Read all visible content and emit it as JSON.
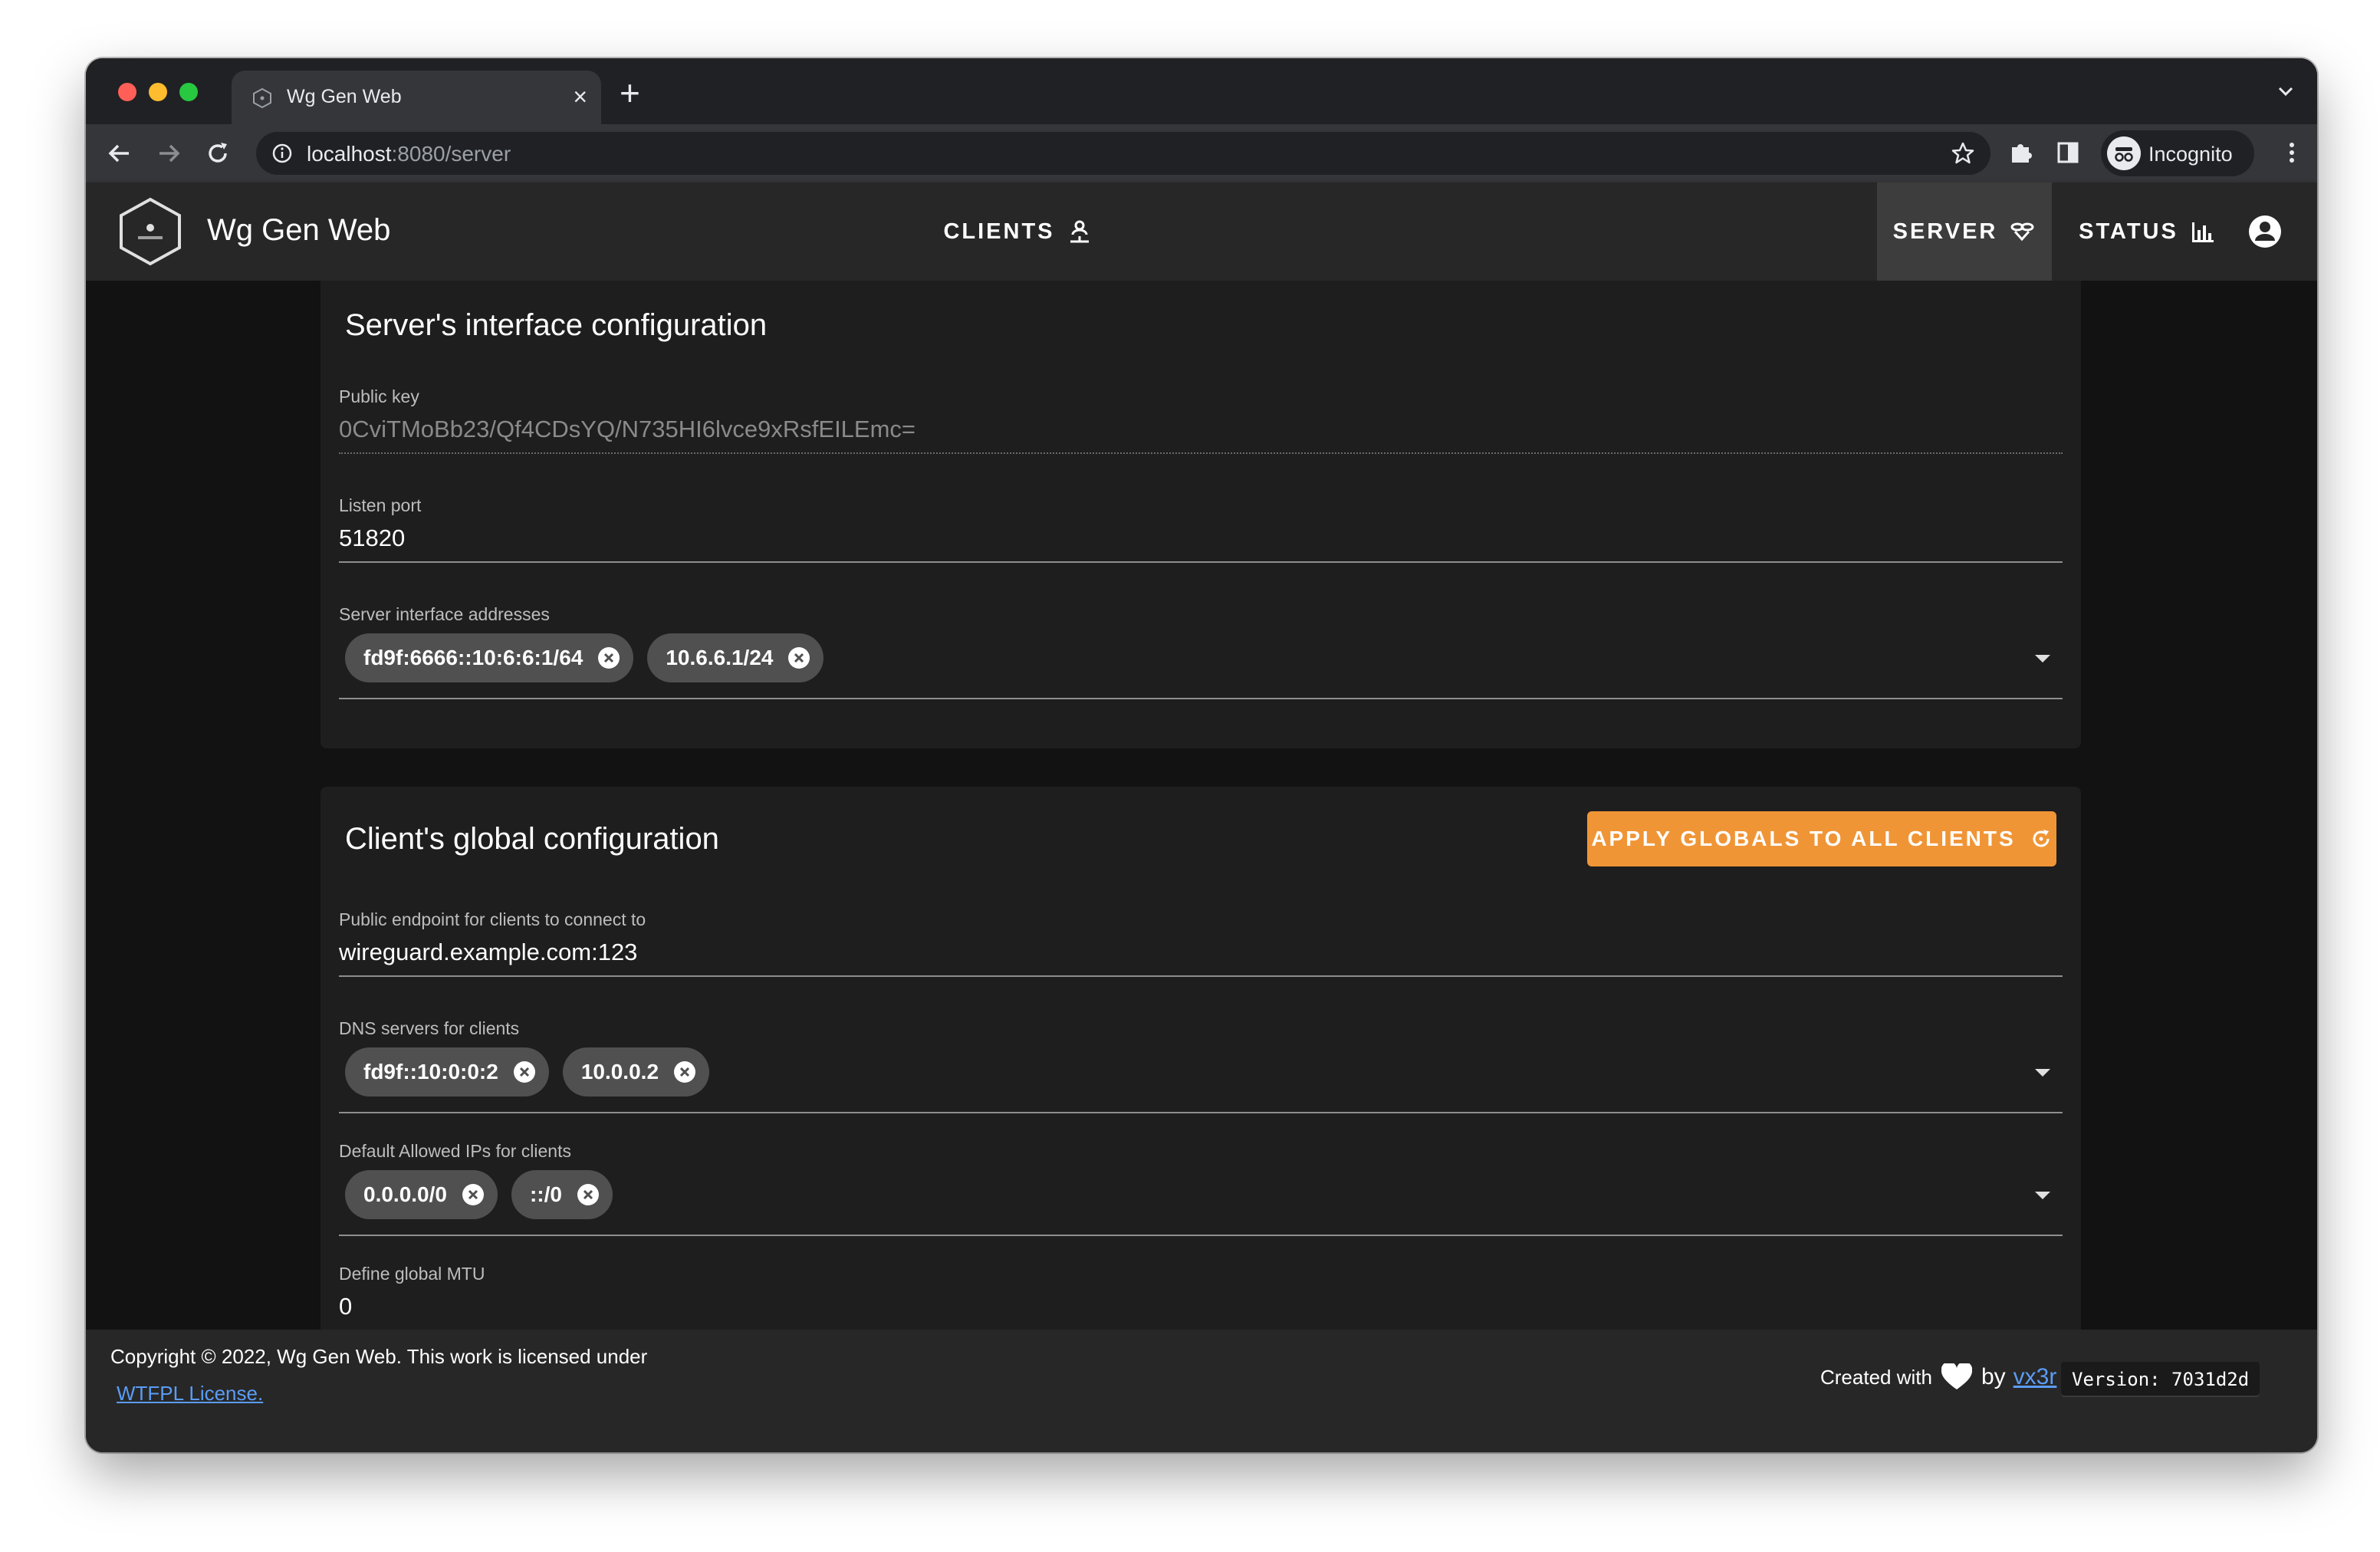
{
  "browser": {
    "tab_title": "Wg Gen Web",
    "new_tab": "+",
    "close_tab": "×",
    "url_host": "localhost",
    "url_path": ":8080/server",
    "profile_label": "Incognito"
  },
  "app": {
    "title": "Wg Gen Web",
    "nav": [
      {
        "label": "CLIENTS",
        "icon": "account-network-icon"
      },
      {
        "label": "SERVER",
        "icon": "server-network-icon",
        "active": true
      },
      {
        "label": "STATUS",
        "icon": "bar-chart-icon"
      }
    ],
    "accent_color": "#f09536"
  },
  "server_card": {
    "title": "Server's interface configuration",
    "public_key_label": "Public key",
    "public_key_value": "0CviTMoBb23/Qf4CDsYQ/N735HI6lvce9xRsfEILEmc=",
    "listen_port_label": "Listen port",
    "listen_port_value": "51820",
    "addresses_label": "Server interface addresses",
    "addresses": [
      "fd9f:6666::10:6:6:1/64",
      "10.6.6.1/24"
    ]
  },
  "client_card": {
    "title": "Client's global configuration",
    "apply_button": "APPLY GLOBALS TO ALL CLIENTS",
    "endpoint_label": "Public endpoint for clients to connect to",
    "endpoint_value": "wireguard.example.com:123",
    "dns_label": "DNS servers for clients",
    "dns": [
      "fd9f::10:0:0:2",
      "10.0.0.2"
    ],
    "allowed_ips_label": "Default Allowed IPs for clients",
    "allowed_ips": [
      "0.0.0.0/0",
      "::/0"
    ],
    "mtu_label": "Define global MTU",
    "mtu_value": "0"
  },
  "footer": {
    "copyright": "Copyright © 2022, Wg Gen Web. This work is licensed under",
    "license_link": "WTFPL License.",
    "created_with": "Created with",
    "by": "by",
    "author": "vx3r",
    "version": "Version: 7031d2d"
  }
}
